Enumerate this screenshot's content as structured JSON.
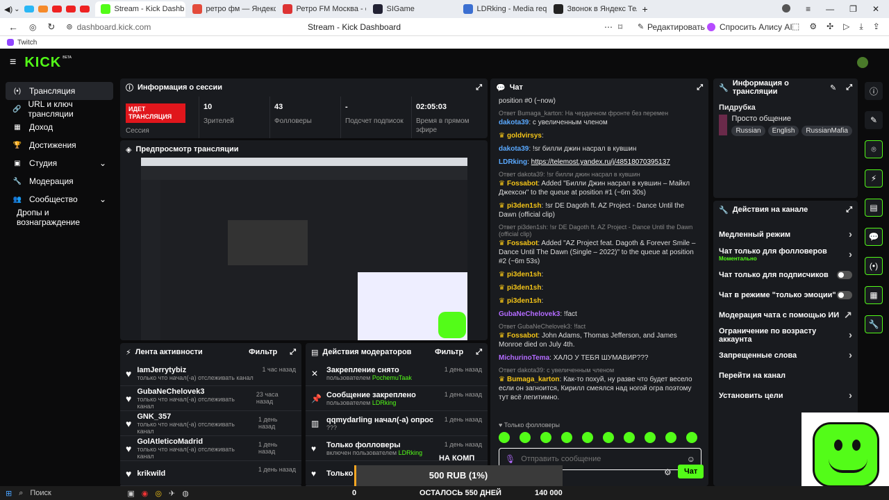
{
  "browser": {
    "tabs": [
      {
        "label": "Stream - Kick Dashb",
        "color": "#53fc18",
        "active": true
      },
      {
        "label": "ретро фм — Яндекс: наш",
        "color": "#e34b3b"
      },
      {
        "label": "Ретро FM Москва - слуш",
        "color": "#d33"
      },
      {
        "label": "SIGame",
        "color": "#223"
      },
      {
        "label": "LDRking - Media reque",
        "color": "#3b6fd1"
      },
      {
        "label": "Звонок в Яндекс Телемос",
        "color": "#222"
      }
    ],
    "url": "dashboard.kick.com",
    "page_title": "Stream - Kick Dashboard",
    "edit_label": "Редактировать",
    "alice_label": "Спросить Алису AI",
    "bookmark": "Twitch"
  },
  "kick": {
    "logo": "KICK",
    "beta": "BETA"
  },
  "sidebar": {
    "items": [
      {
        "label": "Трансляция",
        "icon": "broadcast-icon",
        "glyph": "(•)",
        "active": true
      },
      {
        "label": "URL и ключ трансляции",
        "icon": "link-icon",
        "glyph": "🔗"
      },
      {
        "label": "Доход",
        "icon": "chart-icon",
        "glyph": "▦"
      },
      {
        "label": "Достижения",
        "icon": "trophy-icon",
        "glyph": "🏆"
      },
      {
        "label": "Студия",
        "icon": "studio-icon",
        "glyph": "▣",
        "chev": true
      },
      {
        "label": "Модерация",
        "icon": "wrench-icon",
        "glyph": "🔧"
      },
      {
        "label": "Сообщество",
        "icon": "people-icon",
        "glyph": "👥",
        "chev": true
      },
      {
        "label": "Дропы и вознаграждение",
        "icon": "",
        "glyph": ""
      }
    ]
  },
  "session": {
    "title": "Информация о сессии",
    "live_badge": "ИДЕТ ТРАНСЛЯЦИЯ",
    "session_label": "Сессия",
    "stats": [
      {
        "value": "10",
        "label": "Зрителей"
      },
      {
        "value": "43",
        "label": "Фолловеры"
      },
      {
        "value": "-",
        "label": "Подсчет подписок"
      },
      {
        "value": "02:05:03",
        "label": "Время в прямом эфире"
      }
    ]
  },
  "preview": {
    "title": "Предпросмотр трансляции"
  },
  "activity": {
    "title": "Лента активности",
    "filter": "Фильтр",
    "rows": [
      {
        "name": "IamJerrytybiz",
        "desc": "только что начал(-а) отслеживать канал",
        "time": "1 час назад"
      },
      {
        "name": "GubaNeChelovek3",
        "desc": "только что начал(-а) отслеживать канал",
        "time": "23 часа назад"
      },
      {
        "name": "GNK_357",
        "desc": "только что начал(-а) отслеживать канал",
        "time": "1 день назад"
      },
      {
        "name": "GolAtleticoMadrid",
        "desc": "только что начал(-а) отслеживать канал",
        "time": "1 день назад"
      },
      {
        "name": "krikwild",
        "desc": "",
        "time": "1 день назад"
      }
    ]
  },
  "modactions": {
    "title": "Действия модераторов",
    "filter": "Фильтр",
    "rows": [
      {
        "title": "Закрепление снято",
        "by": "пользователем ",
        "user": "PochemuTaak",
        "time": "1 день назад",
        "icon": "unpin-icon",
        "glyph": "✕"
      },
      {
        "title": "Сообщение закреплено",
        "by": "пользователем ",
        "user": "LDRking",
        "time": "1 день назад",
        "icon": "pin-icon",
        "glyph": "📌"
      },
      {
        "title": "qqmydarling начал(-а) опрос",
        "by": "???",
        "user": "",
        "time": "1 день назад",
        "icon": "poll-icon",
        "glyph": "▥"
      },
      {
        "title": "Только фолловеры",
        "by": "включен пользователем ",
        "user": "LDRking",
        "time": "1 день назад",
        "icon": "heart-icon",
        "glyph": "♥"
      },
      {
        "title": "Только",
        "by": "",
        "user": "",
        "time": "1 день назад",
        "icon": "heart-icon",
        "glyph": "♥"
      }
    ],
    "overlay_text": "НА КОМП"
  },
  "chat": {
    "title": "Чат",
    "messages": [
      {
        "text": "position #0 (~now)"
      },
      {
        "reply": "Ответ Bumaga_karton: На чердачном фронте без перемен",
        "user": "dakota39",
        "color": "#5aa9ff",
        "text": ": с увеличенным членом"
      },
      {
        "user": "goldvirsys",
        "color": "#f5c518",
        "text": ":"
      },
      {
        "user": "dakota39",
        "color": "#5aa9ff",
        "text": ": !sr билли джин насрал в кувшин"
      },
      {
        "user": "LDRking",
        "color": "#5aa9ff",
        "text": ": ",
        "link": "https://telemost.yandex.ru/j/48518070395137"
      },
      {
        "reply": "Ответ dakota39: !sr билли джин насрал в кувшин",
        "user": "Fossabot",
        "color": "#f5c518",
        "text": ": Added \"Билли Джин насрал в кувшин – Майкл Джексон\" to the queue at position #1 (~6m 30s)"
      },
      {
        "user": "pi3den1sh",
        "color": "#f5c518",
        "text": ": !sr DE Dagoth ft. AZ Project - Dance Until the Dawn (official clip)"
      },
      {
        "reply": "Ответ pi3den1sh: !sr DE Dagoth ft. AZ Project - Dance Until the Dawn (official clip)",
        "user": "Fossabot",
        "color": "#f5c518",
        "text": ": Added \"AZ Project feat. Dagoth & Forever Smile – Dance Until The Dawn (Single – 2022)\" to the queue at position #2 (~6m 53s)"
      },
      {
        "user": "pi3den1sh",
        "color": "#f5c518",
        "text": ":"
      },
      {
        "user": "pi3den1sh",
        "color": "#f5c518",
        "text": ":"
      },
      {
        "user": "pi3den1sh",
        "color": "#f5c518",
        "text": ":"
      },
      {
        "user": "GubaNeChelovek3",
        "color": "#b36bff",
        "text": ": !fact"
      },
      {
        "reply": "Ответ GubaNeChelovek3: !fact",
        "user": "Fossabot",
        "color": "#f5c518",
        "text": ": John Adams, Thomas Jefferson, and James Monroe died on July 4th."
      },
      {
        "user": "MichurinoTema",
        "color": "#b36bff",
        "text": ": ХАЛО У ТЕБЯ ШУМАВИР???"
      },
      {
        "reply": "Ответ dakota39: с увеличенным членом",
        "user": "Bumaga_karton",
        "color": "#f5c518",
        "text": ": Как-то похуй, ну разве что будет весело если он загноится, Кирилл смеялся над ногой огра поэтому тут всё легитимно."
      }
    ],
    "followers_only": "♥ Только фолловеры",
    "placeholder": "Отправить сообщение",
    "send": "Чат"
  },
  "stream_info": {
    "title": "Информация о трансляции",
    "category": "Пидрубка",
    "stream_title": "Просто общение",
    "tags": [
      "Russian",
      "English",
      "RussianMafia"
    ]
  },
  "channel_actions": {
    "title": "Действия на канале",
    "rows": [
      {
        "label": "Медленный режим",
        "ctrl": "›"
      },
      {
        "label": "Чат только для фолловеров",
        "sub": "Моментально",
        "ctrl": "›"
      },
      {
        "label": "Чат только для подписчиков",
        "ctrl": "toggle"
      },
      {
        "label": "Чат в режиме \"только эмоции\"",
        "ctrl": "toggle"
      },
      {
        "label": "Модерация чата с помощью ИИ",
        "ctrl": "↗"
      },
      {
        "label": "Ограничение по возрасту аккаунта",
        "ctrl": "›"
      },
      {
        "label": "Запрещенные слова",
        "ctrl": "›"
      },
      {
        "label": "Перейти на канал",
        "ctrl": ""
      },
      {
        "label": "Установить цели",
        "ctrl": "›"
      }
    ]
  },
  "goal": {
    "amount": "500 RUB (1%)",
    "left": "0",
    "days": "ОСТАЛОСЬ 550 ДНЕЙ",
    "target": "140 000"
  },
  "taskbar": {
    "search": "Поиск"
  }
}
